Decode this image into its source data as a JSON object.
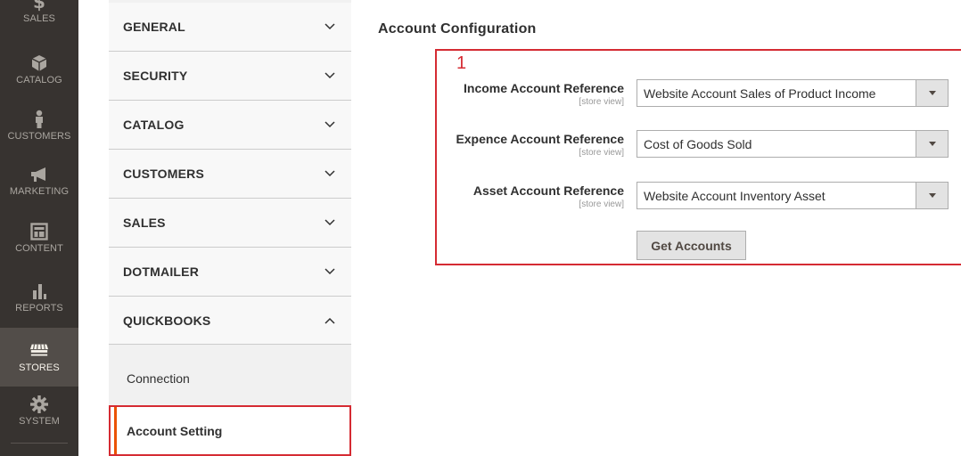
{
  "admin_nav": {
    "items": [
      {
        "key": "sales",
        "label": "SALES",
        "icon": "dollar-icon"
      },
      {
        "key": "catalog",
        "label": "CATALOG",
        "icon": "box-icon"
      },
      {
        "key": "customers",
        "label": "CUSTOMERS",
        "icon": "person-icon"
      },
      {
        "key": "marketing",
        "label": "MARKETING",
        "icon": "megaphone-icon"
      },
      {
        "key": "content",
        "label": "CONTENT",
        "icon": "layout-icon"
      },
      {
        "key": "reports",
        "label": "REPORTS",
        "icon": "bar-chart-icon"
      },
      {
        "key": "stores",
        "label": "STORES",
        "icon": "storefront-icon",
        "active": true
      },
      {
        "key": "system",
        "label": "SYSTEM",
        "icon": "gear-icon"
      }
    ],
    "colors": {
      "background": "#373330",
      "active_background": "#524d49"
    }
  },
  "config_tabs": {
    "sections": [
      {
        "label": "GENERAL",
        "expanded": false
      },
      {
        "label": "SECURITY",
        "expanded": false
      },
      {
        "label": "CATALOG",
        "expanded": false
      },
      {
        "label": "CUSTOMERS",
        "expanded": false
      },
      {
        "label": "SALES",
        "expanded": false
      },
      {
        "label": "DOTMAILER",
        "expanded": false
      },
      {
        "label": "QUICKBOOKS",
        "expanded": true
      }
    ],
    "quickbooks_items": [
      {
        "label": "Connection",
        "active": false
      },
      {
        "label": "Account Setting",
        "active": true
      }
    ]
  },
  "main": {
    "section_title": "Account Configuration",
    "marker": "1",
    "fields": [
      {
        "label": "Income Account Reference",
        "scope": "[store view]",
        "value": "Website Account Sales of Product Income"
      },
      {
        "label": "Expence Account Reference",
        "scope": "[store view]",
        "value": "Cost of Goods Sold"
      },
      {
        "label": "Asset Account Reference",
        "scope": "[store view]",
        "value": "Website Account Inventory Asset"
      }
    ],
    "get_accounts_button": "Get Accounts"
  },
  "colors": {
    "highlight": "#d52b33",
    "active_accent": "#eb5202"
  }
}
